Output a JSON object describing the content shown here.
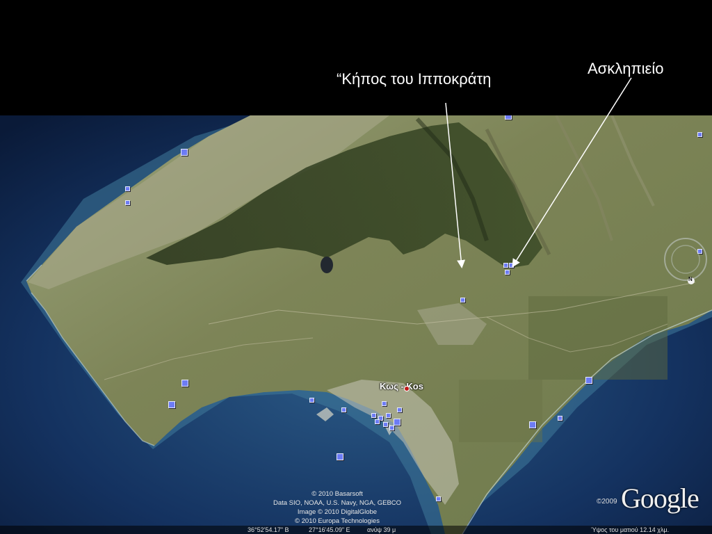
{
  "annotations": {
    "garden_label": "“Κήπος του Ιπποκράτη",
    "asklepieion_label": "Ασκληπιείο"
  },
  "map": {
    "city_label": "Κως - Kos",
    "compass_north": "N"
  },
  "credits": {
    "line1": "© 2010 Basarsoft",
    "line2": "Data SIO, NOAA, U.S. Navy, NGA, GEBCO",
    "line3": "Image © 2010 DigitalGlobe",
    "line4": "© 2010 Europa Technologies"
  },
  "status": {
    "lat": "36°52'54.17\" Β",
    "lon": "27°16'45.09\" Ε",
    "elevation": "ανύψ   39 μ",
    "eye_alt": "Ύψος του ματιού   12.14 χλμ."
  },
  "branding": {
    "copyright_year": "©2009",
    "logo": "Google"
  },
  "colors": {
    "sea_deep": "#0d2244",
    "sea_shallow": "#3f7a9a",
    "land": "#7d8457",
    "forest": "#2c3a1e",
    "placemark": "#6d7cf5"
  }
}
